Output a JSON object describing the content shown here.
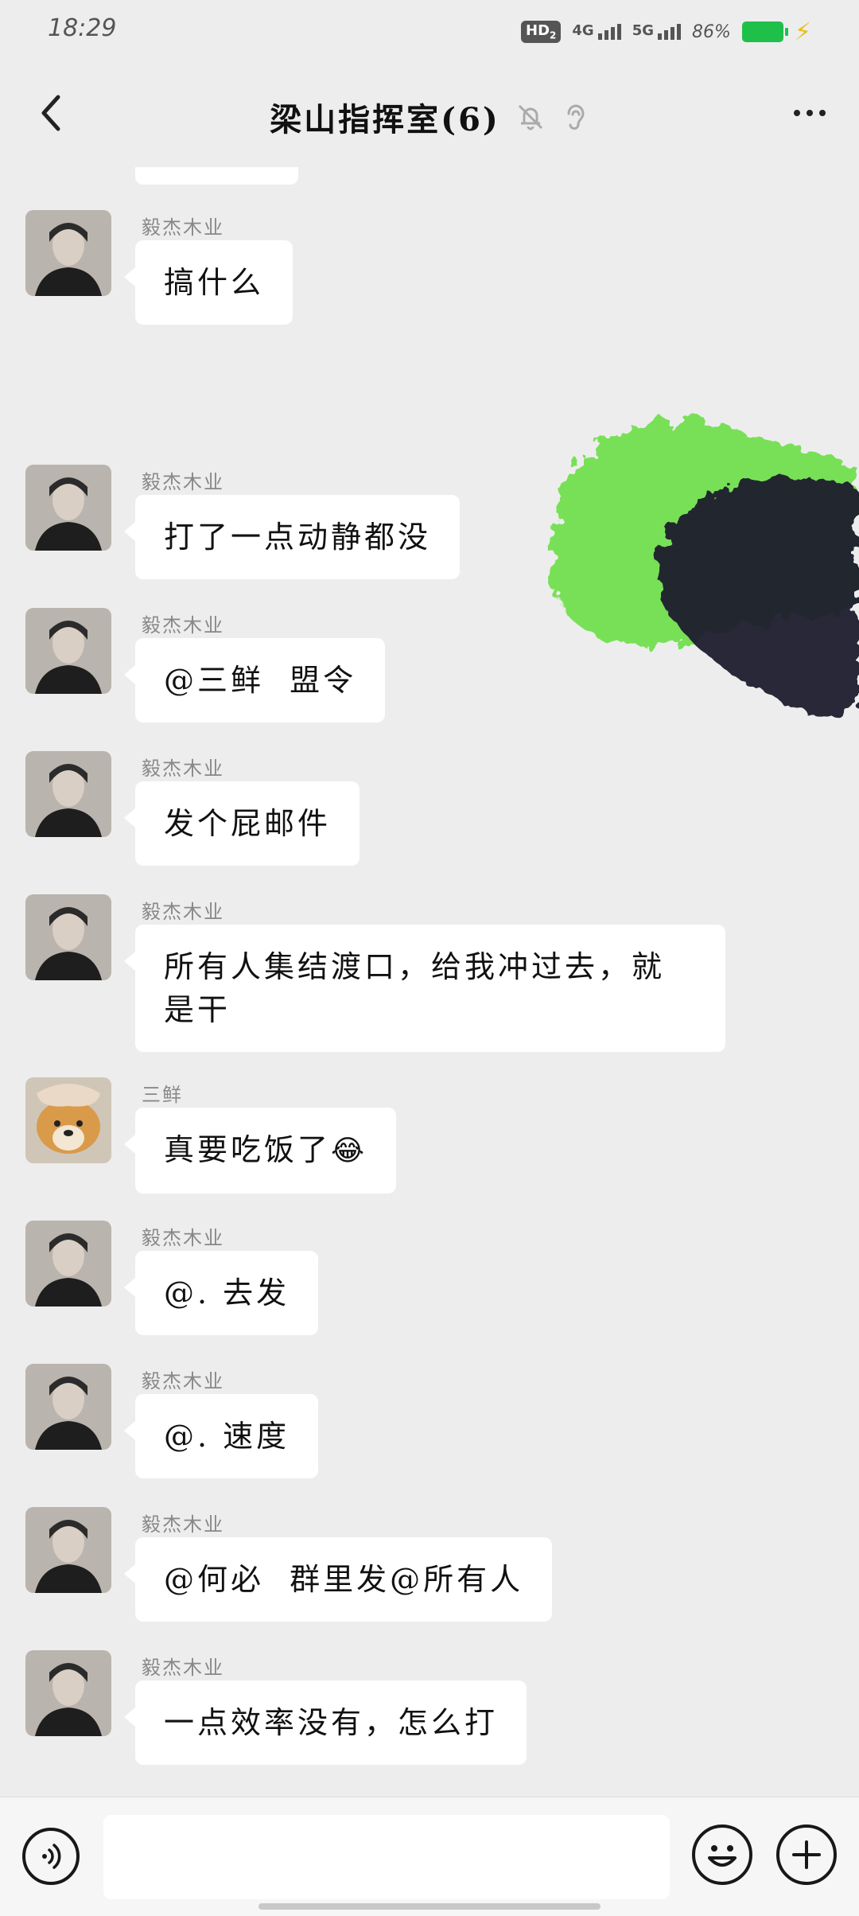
{
  "status_bar": {
    "time": "18:29",
    "hd": "HD",
    "hd_sub": "2",
    "net1": "4G",
    "net2": "5G",
    "battery": "86%"
  },
  "header": {
    "title": "梁山指挥室(6)",
    "icons": [
      "back-icon",
      "mute-bell-icon",
      "ear-icon",
      "more-icon"
    ]
  },
  "messages": [
    {
      "sender": "毅杰木业",
      "text": "搞什么"
    },
    {
      "sender": "毅杰木业",
      "text": "打了一点动静都没"
    },
    {
      "sender": "毅杰木业",
      "text": "@三鲜  盟令"
    },
    {
      "sender": "毅杰木业",
      "text": "发个屁邮件"
    },
    {
      "sender": "毅杰木业",
      "text_line1": "所有人集结渡口，给我冲过去，就",
      "text_line2": "是干"
    },
    {
      "sender": "三鲜",
      "text": "真要吃饭了",
      "emoji": "😂"
    },
    {
      "sender": "毅杰木业",
      "text": "@. 去发"
    },
    {
      "sender": "毅杰木业",
      "text": "@. 速度"
    },
    {
      "sender": "毅杰木业",
      "text": "@何必  群里发@所有人"
    },
    {
      "sender": "毅杰木业",
      "text": "一点效率没有，怎么打"
    }
  ],
  "input_bar": {
    "placeholder": "",
    "icons": [
      "voice-icon",
      "emoji-icon",
      "plus-icon"
    ]
  },
  "colors": {
    "background": "#ededed",
    "bubble": "#ffffff",
    "battery": "#1fc04a",
    "splash_green": "#6fe04a",
    "splash_dark": "#1c1f2e"
  }
}
